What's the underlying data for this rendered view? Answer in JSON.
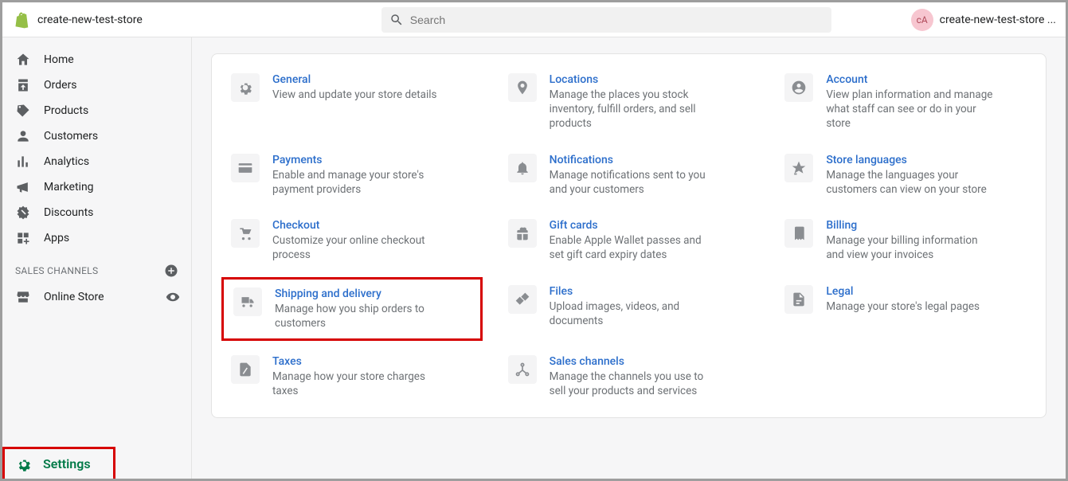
{
  "topbar": {
    "store_name": "create-new-test-store",
    "search_placeholder": "Search",
    "avatar_initials": "cA",
    "user_label": "create-new-test-store ..."
  },
  "sidebar": {
    "items": [
      {
        "label": "Home"
      },
      {
        "label": "Orders"
      },
      {
        "label": "Products"
      },
      {
        "label": "Customers"
      },
      {
        "label": "Analytics"
      },
      {
        "label": "Marketing"
      },
      {
        "label": "Discounts"
      },
      {
        "label": "Apps"
      }
    ],
    "channels_header": "SALES CHANNELS",
    "channels": [
      {
        "label": "Online Store"
      }
    ],
    "settings_label": "Settings"
  },
  "settings_grid": [
    {
      "key": "general",
      "title": "General",
      "desc": "View and update your store details"
    },
    {
      "key": "locations",
      "title": "Locations",
      "desc": "Manage the places you stock inventory, fulfill orders, and sell products"
    },
    {
      "key": "account",
      "title": "Account",
      "desc": "View plan information and manage what staff can see or do in your store"
    },
    {
      "key": "payments",
      "title": "Payments",
      "desc": "Enable and manage your store's payment providers"
    },
    {
      "key": "notifications",
      "title": "Notifications",
      "desc": "Manage notifications sent to you and your customers"
    },
    {
      "key": "store-languages",
      "title": "Store languages",
      "desc": "Manage the languages your customers can view on your store"
    },
    {
      "key": "checkout",
      "title": "Checkout",
      "desc": "Customize your online checkout process"
    },
    {
      "key": "gift-cards",
      "title": "Gift cards",
      "desc": "Enable Apple Wallet passes and set gift card expiry dates"
    },
    {
      "key": "billing",
      "title": "Billing",
      "desc": "Manage your billing information and view your invoices"
    },
    {
      "key": "shipping",
      "title": "Shipping and delivery",
      "desc": "Manage how you ship orders to customers",
      "highlight": true
    },
    {
      "key": "files",
      "title": "Files",
      "desc": "Upload images, videos, and documents"
    },
    {
      "key": "legal",
      "title": "Legal",
      "desc": "Manage your store's legal pages"
    },
    {
      "key": "taxes",
      "title": "Taxes",
      "desc": "Manage how your store charges taxes"
    },
    {
      "key": "sales-channels",
      "title": "Sales channels",
      "desc": "Manage the channels you use to sell your products and services"
    }
  ]
}
